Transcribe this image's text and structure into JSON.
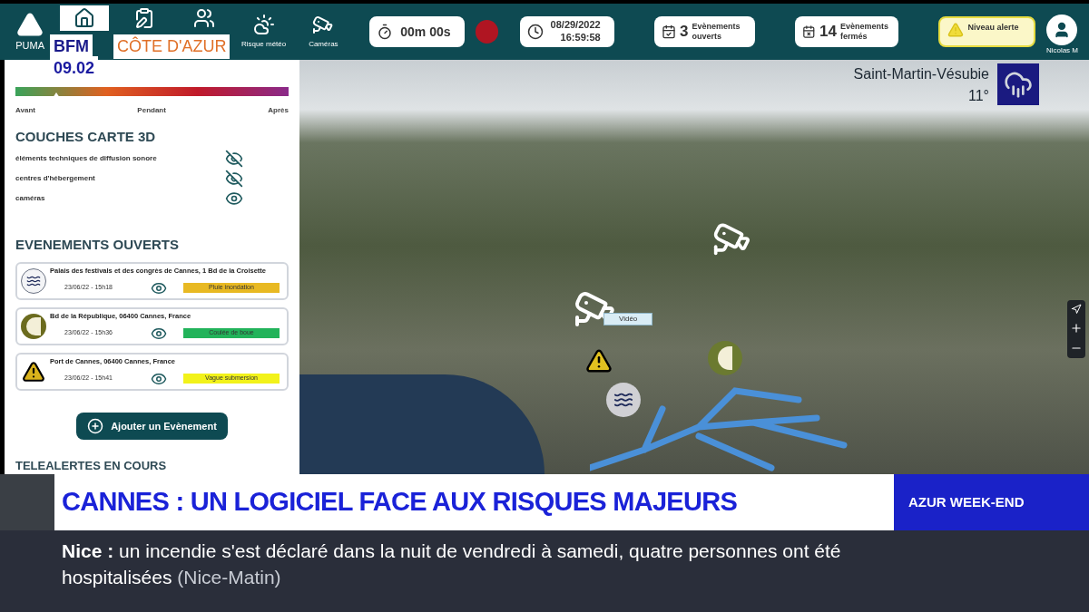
{
  "app": {
    "logo": "PUMA"
  },
  "nav": [
    {
      "kind": "home",
      "selected": true
    },
    {
      "kind": "clipboard",
      "selected": false
    },
    {
      "kind": "people",
      "selected": false
    },
    {
      "kind": "weather",
      "label": "Risque météo",
      "selected": false
    },
    {
      "kind": "camera",
      "label": "Caméras",
      "selected": false
    }
  ],
  "timer": {
    "value": "00m 00s",
    "recording": true
  },
  "datetime": {
    "date": "08/29/2022",
    "time": "16:59:58"
  },
  "counters": [
    {
      "kind": "open",
      "count": "3",
      "label": "Evènements ouverts"
    },
    {
      "kind": "closed",
      "count": "14",
      "label": "Evènements fermés"
    }
  ],
  "alert": {
    "label": "Niveau alerte"
  },
  "user": {
    "name": "Nicolas M"
  },
  "timeline": {
    "level": 0.15,
    "labels": [
      "Avant",
      "Pendant",
      "Après"
    ]
  },
  "layers": {
    "title": "COUCHES CARTE 3D",
    "items": [
      {
        "name": "éléments techniques de diffusion sonore",
        "visible": false
      },
      {
        "name": "centres d'hébergement",
        "visible": false
      },
      {
        "name": "caméras",
        "visible": true
      }
    ]
  },
  "events": {
    "title": "EVENEMENTS OUVERTS",
    "items": [
      {
        "kind": "flood",
        "address": "Palais des festivals et des congrès de Cannes, 1 Bd de la Croisette",
        "date": "23/06/22 - 15h18",
        "tag": "Pluie inondation",
        "color": "#e8b923"
      },
      {
        "kind": "mudslide",
        "address": "Bd de la République, 06400 Cannes, France",
        "date": "23/06/22 - 15h36",
        "tag": "Coulée de boue",
        "color": "#22b35a"
      },
      {
        "kind": "wave",
        "address": "Port de Cannes, 06400 Cannes, France",
        "date": "23/06/22 - 15h41",
        "tag": "Vague submersion",
        "color": "#f2f21a"
      }
    ]
  },
  "add_event": "Ajouter un Evènement",
  "telealerts": {
    "title": "TELEALERTES EN COURS"
  },
  "map": {
    "tooltip": "Vidéo"
  },
  "broadcast": {
    "channel": "BFM",
    "clock": "09.02",
    "region": "CÔTE D'AZUR",
    "weather": {
      "place": "Saint-Martin-Vésubie",
      "temp": "11°"
    },
    "headline": "CANNES : UN LOGICIEL FACE AUX RISQUES MAJEURS",
    "show": "AZUR WEEK-END",
    "ticker": "**Nice :** un incendie s'est déclaré dans la nuit de vendredi à samedi, quatre personnes ont été hospitalisées",
    "source": "(Nice-Matin)"
  }
}
